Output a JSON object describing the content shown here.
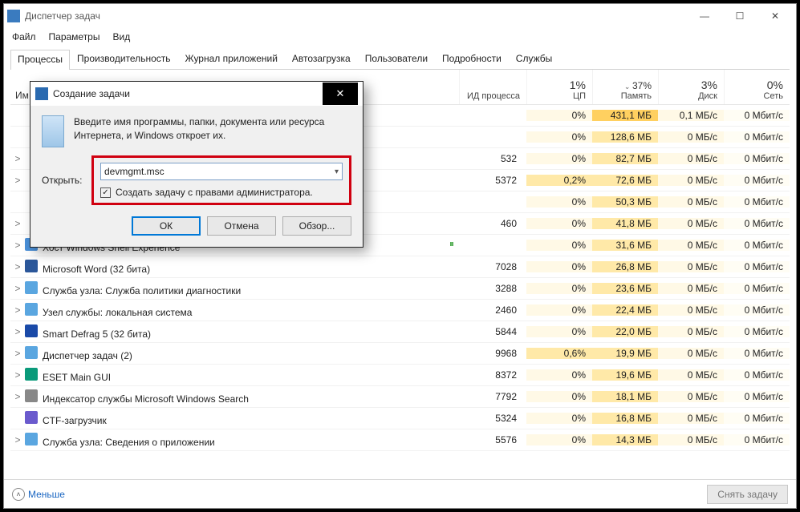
{
  "window": {
    "title": "Диспетчер задач"
  },
  "menu": {
    "file": "Файл",
    "params": "Параметры",
    "view": "Вид"
  },
  "tabs": {
    "processes": "Процессы",
    "performance": "Производительность",
    "apphistory": "Журнал приложений",
    "startup": "Автозагрузка",
    "users": "Пользователи",
    "details": "Подробности",
    "services": "Службы"
  },
  "columns": {
    "name": "Им",
    "pid": "ИД процесса",
    "cpu_pct": "1%",
    "cpu_lbl": "ЦП",
    "mem_pct": "37%",
    "mem_lbl": "Память",
    "disk_pct": "3%",
    "disk_lbl": "Диск",
    "net_pct": "0%",
    "net_lbl": "Сеть"
  },
  "rows": [
    {
      "exp": "",
      "name": "",
      "pid": "",
      "cpu": "0%",
      "mem": "431,1 МБ",
      "disk": "0,1 МБ/с",
      "net": "0 Мбит/с",
      "memhl": true
    },
    {
      "exp": "",
      "name": "",
      "pid": "",
      "cpu": "0%",
      "mem": "128,6 МБ",
      "disk": "0 МБ/с",
      "net": "0 Мбит/с"
    },
    {
      "exp": ">",
      "name": "",
      "pid": "532",
      "cpu": "0%",
      "mem": "82,7 МБ",
      "disk": "0 МБ/с",
      "net": "0 Мбит/с"
    },
    {
      "exp": ">",
      "name": "",
      "pid": "5372",
      "cpu": "0,2%",
      "mem": "72,6 МБ",
      "disk": "0 МБ/с",
      "net": "0 Мбит/с",
      "cpuhl": true
    },
    {
      "exp": "",
      "name": "",
      "pid": "",
      "cpu": "0%",
      "mem": "50,3 МБ",
      "disk": "0 МБ/с",
      "net": "0 Мбит/с"
    },
    {
      "exp": ">",
      "name": "",
      "pid": "460",
      "cpu": "0%",
      "mem": "41,8 МБ",
      "disk": "0 МБ/с",
      "net": "0 Мбит/с"
    },
    {
      "exp": ">",
      "name": "Хост Windows Shell Experience",
      "pid": "",
      "cpu": "0%",
      "mem": "31,6 МБ",
      "disk": "0 МБ/с",
      "net": "0 Мбит/с",
      "icon": "#4a90d9",
      "susp": true
    },
    {
      "exp": ">",
      "name": "Microsoft Word (32 бита)",
      "pid": "7028",
      "cpu": "0%",
      "mem": "26,8 МБ",
      "disk": "0 МБ/с",
      "net": "0 Мбит/с",
      "icon": "#2b579a"
    },
    {
      "exp": ">",
      "name": "Служба узла: Служба политики диагностики",
      "pid": "3288",
      "cpu": "0%",
      "mem": "23,6 МБ",
      "disk": "0 МБ/с",
      "net": "0 Мбит/с",
      "icon": "#5aa6e0"
    },
    {
      "exp": ">",
      "name": "Узел службы: локальная система",
      "pid": "2460",
      "cpu": "0%",
      "mem": "22,4 МБ",
      "disk": "0 МБ/с",
      "net": "0 Мбит/с",
      "icon": "#5aa6e0"
    },
    {
      "exp": ">",
      "name": "Smart Defrag 5 (32 бита)",
      "pid": "5844",
      "cpu": "0%",
      "mem": "22,0 МБ",
      "disk": "0 МБ/с",
      "net": "0 Мбит/с",
      "icon": "#1a4aa8"
    },
    {
      "exp": ">",
      "name": "Диспетчер задач (2)",
      "pid": "9968",
      "cpu": "0,6%",
      "mem": "19,9 МБ",
      "disk": "0 МБ/с",
      "net": "0 Мбит/с",
      "icon": "#5aa6e0",
      "cpuhl": true
    },
    {
      "exp": ">",
      "name": "ESET Main GUI",
      "pid": "8372",
      "cpu": "0%",
      "mem": "19,6 МБ",
      "disk": "0 МБ/с",
      "net": "0 Мбит/с",
      "icon": "#0a9a7a"
    },
    {
      "exp": ">",
      "name": "Индексатор службы Microsoft Windows Search",
      "pid": "7792",
      "cpu": "0%",
      "mem": "18,1 МБ",
      "disk": "0 МБ/с",
      "net": "0 Мбит/с",
      "icon": "#888888"
    },
    {
      "exp": "",
      "name": "CTF-загрузчик",
      "pid": "5324",
      "cpu": "0%",
      "mem": "16,8 МБ",
      "disk": "0 МБ/с",
      "net": "0 Мбит/с",
      "icon": "#6a5acd"
    },
    {
      "exp": ">",
      "name": "Служба узла: Сведения о приложении",
      "pid": "5576",
      "cpu": "0%",
      "mem": "14,3 МБ",
      "disk": "0 МБ/с",
      "net": "0 Мбит/с",
      "icon": "#5aa6e0"
    }
  ],
  "footer": {
    "less": "Меньше",
    "end_task": "Снять задачу"
  },
  "dialog": {
    "title": "Создание задачи",
    "desc": "Введите имя программы, папки, документа или ресурса Интернета, и Windows откроет их.",
    "open_label": "Открыть:",
    "open_value": "devmgmt.msc",
    "admin_check": "Создать задачу с правами администратора.",
    "ok": "ОК",
    "cancel": "Отмена",
    "browse": "Обзор..."
  }
}
